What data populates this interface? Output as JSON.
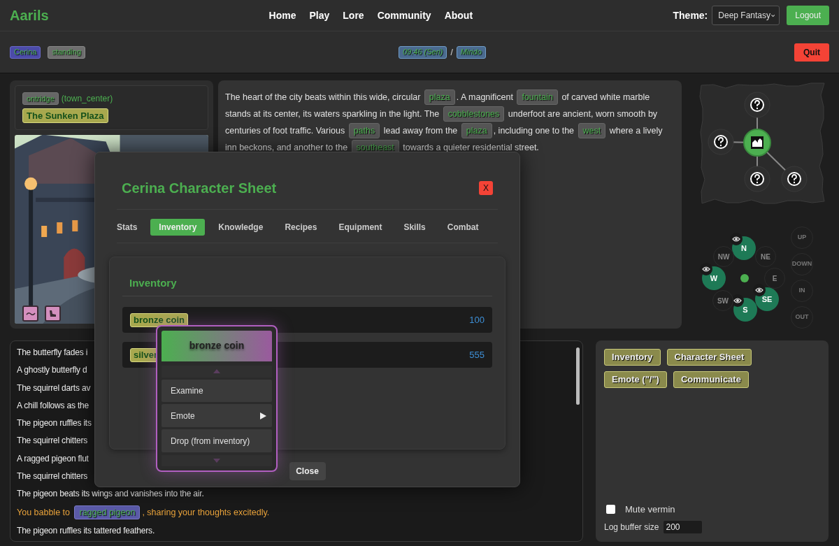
{
  "header": {
    "logo": "Aarils",
    "nav": [
      "Home",
      "Play",
      "Lore",
      "Community",
      "About"
    ],
    "theme_label": "Theme:",
    "theme_value": "Deep Fantasy",
    "logout": "Logout"
  },
  "status_bar": {
    "character": "Cerina",
    "posture": "standing",
    "time": "09:46 (Seri)",
    "separator": "/",
    "place": "Mirido",
    "quit": "Quit"
  },
  "location": {
    "area": "ontridge",
    "zone": "(town_center)",
    "name": "The Sunken Plaza"
  },
  "description": [
    {
      "kind": "text",
      "text": "The heart of the city beats within this wide, circular "
    },
    {
      "kind": "link",
      "text": "plaza"
    },
    {
      "kind": "text",
      "text": ". A magnificent "
    },
    {
      "kind": "link",
      "text": "fountain"
    },
    {
      "kind": "text",
      "text": " of carved white marble stands at its center, its waters sparkling in the light. The "
    },
    {
      "kind": "link",
      "text": "cobblestones"
    },
    {
      "kind": "text",
      "text": " underfoot are ancient, worn smooth by centuries of foot traffic. Various "
    },
    {
      "kind": "link",
      "text": "paths"
    },
    {
      "kind": "text",
      "text": " lead away from the "
    },
    {
      "kind": "link",
      "text": "plaza"
    },
    {
      "kind": "text",
      "text": ", including one to the "
    },
    {
      "kind": "link",
      "text": "west"
    },
    {
      "kind": "text",
      "text": " where a lively inn beckons, and another to the "
    },
    {
      "kind": "link",
      "text": "southeast"
    },
    {
      "kind": "text",
      "text": " towards a quieter residential street."
    }
  ],
  "map": {
    "nodes": [
      {
        "kind": "current"
      },
      {
        "kind": "unknown"
      },
      {
        "kind": "unknown"
      },
      {
        "kind": "unknown"
      },
      {
        "kind": "unknown"
      }
    ]
  },
  "exits": [
    {
      "label": "N",
      "open": true,
      "seen": true
    },
    {
      "label": "NE",
      "open": false,
      "seen": false
    },
    {
      "label": "E",
      "open": false,
      "seen": false
    },
    {
      "label": "SE",
      "open": true,
      "seen": true
    },
    {
      "label": "S",
      "open": true,
      "seen": true
    },
    {
      "label": "SW",
      "open": false,
      "seen": false
    },
    {
      "label": "W",
      "open": true,
      "seen": true
    },
    {
      "label": "NW",
      "open": false,
      "seen": false
    }
  ],
  "vertical_exits": [
    {
      "label": "UP",
      "open": false
    },
    {
      "label": "DOWN",
      "open": false
    },
    {
      "label": "IN",
      "open": false
    },
    {
      "label": "OUT",
      "open": false
    }
  ],
  "log": [
    {
      "kind": "plain",
      "text": "The butterfly fades i"
    },
    {
      "kind": "plain",
      "text": "A ghostly butterfly d"
    },
    {
      "kind": "plain",
      "text": "The squirrel darts av"
    },
    {
      "kind": "plain",
      "text": "A chill follows as the"
    },
    {
      "kind": "plain",
      "text": "The pigeon ruffles its"
    },
    {
      "kind": "plain",
      "text": "The squirrel chitters"
    },
    {
      "kind": "plain",
      "text": "A ragged pigeon flut"
    },
    {
      "kind": "plain",
      "text": "The squirrel chitters"
    },
    {
      "kind": "plain",
      "text": "The pigeon beats its wings and vanishes into the air."
    },
    {
      "kind": "speech",
      "text": "You babble to ",
      "target": "ragged pigeon",
      "rest": ", sharing your thoughts excitedly."
    },
    {
      "kind": "plain",
      "text": "The pigeon ruffles its tattered feathers."
    }
  ],
  "actions": {
    "buttons": [
      "Inventory",
      "Character Sheet",
      "Emote (\"/\")",
      "Communicate"
    ],
    "mute_vermin": {
      "label": "Mute vermin",
      "checked": false
    },
    "log_buffer": {
      "label": "Log buffer size",
      "value": "200"
    }
  },
  "character_sheet": {
    "title": "Cerina Character Sheet",
    "close_x": "X",
    "tabs": [
      {
        "label": "Stats",
        "selected": false
      },
      {
        "label": "Inventory",
        "selected": true
      },
      {
        "label": "Knowledge",
        "selected": false
      },
      {
        "label": "Recipes",
        "selected": false
      },
      {
        "label": "Equipment",
        "selected": false
      },
      {
        "label": "Skills",
        "selected": false
      },
      {
        "label": "Combat",
        "selected": false
      }
    ],
    "section_title": "Inventory",
    "items": [
      {
        "name": "bronze coin",
        "count": "100"
      },
      {
        "name": "silver",
        "count": "555"
      }
    ],
    "close": "Close"
  },
  "context_menu": {
    "title": "bronze coin",
    "items": [
      {
        "label": "Examine",
        "submenu": false
      },
      {
        "label": "Emote",
        "submenu": true
      },
      {
        "label": "Drop (from inventory)",
        "submenu": false
      }
    ]
  }
}
